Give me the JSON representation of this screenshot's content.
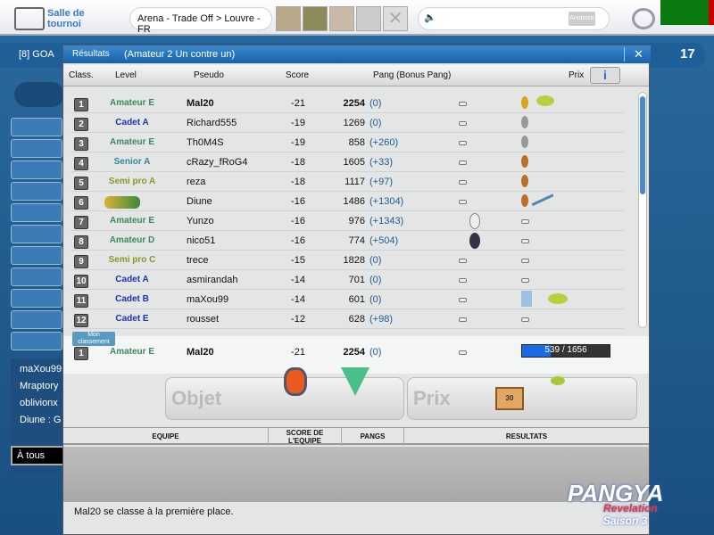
{
  "topbar": {
    "lobby_label": "Salle de tournoi",
    "location": "Arena - Trade Off > Louvre - FR",
    "announce_button": "Annonce"
  },
  "room": {
    "info": "[8]  GOA",
    "count": "17"
  },
  "dialog": {
    "title": "Résultats",
    "subtitle": "(Amateur 2 Un contre un)",
    "columns": [
      "Class.",
      "Level",
      "Pseudo",
      "Score",
      "Pang (Bonus Pang)",
      "Prix"
    ],
    "rows": [
      {
        "rank": "1",
        "level": "Amateur E",
        "pseudo": "Mal20",
        "score": "-21",
        "pang": "2254",
        "bonus": "(0)",
        "prize": "gold-medal"
      },
      {
        "rank": "2",
        "level": "Cadet A",
        "pseudo": "Richard555",
        "score": "-19",
        "pang": "1269",
        "bonus": "(0)",
        "prize": "silver-medal"
      },
      {
        "rank": "3",
        "level": "Amateur E",
        "pseudo": "Th0M4S",
        "score": "-19",
        "pang": "858",
        "bonus": "(+260)",
        "prize": "silver-medal"
      },
      {
        "rank": "4",
        "level": "Senior A",
        "pseudo": "cRazy_fRoG4",
        "score": "-18",
        "pang": "1605",
        "bonus": "(+33)",
        "prize": "bronze-medal"
      },
      {
        "rank": "5",
        "level": "Semi pro A",
        "pseudo": "reza",
        "score": "-18",
        "pang": "1117",
        "bonus": "(+97)",
        "prize": "bronze-medal"
      },
      {
        "rank": "6",
        "level": "",
        "pseudo": "Diune",
        "score": "-16",
        "pang": "1486",
        "bonus": "(+1304)",
        "prize": "bronze-medal"
      },
      {
        "rank": "7",
        "level": "Amateur E",
        "pseudo": "Yunzo",
        "score": "-16",
        "pang": "976",
        "bonus": "(+1343)",
        "prize": "none"
      },
      {
        "rank": "8",
        "level": "Amateur D",
        "pseudo": "nico51",
        "score": "-16",
        "pang": "774",
        "bonus": "(+504)",
        "prize": "none"
      },
      {
        "rank": "9",
        "level": "Semi pro C",
        "pseudo": "trece",
        "score": "-15",
        "pang": "1828",
        "bonus": "(0)",
        "prize": "none"
      },
      {
        "rank": "10",
        "level": "Cadet A",
        "pseudo": "asmirandah",
        "score": "-14",
        "pang": "701",
        "bonus": "(0)",
        "prize": "none"
      },
      {
        "rank": "11",
        "level": "Cadet B",
        "pseudo": "maXou99",
        "score": "-14",
        "pang": "601",
        "bonus": "(0)",
        "prize": "figure"
      },
      {
        "rank": "12",
        "level": "Cadet E",
        "pseudo": "rousset",
        "score": "-12",
        "pang": "628",
        "bonus": "(+98)",
        "prize": "none"
      }
    ],
    "my_rank": {
      "tag": "Mon classement",
      "rank": "1",
      "level": "Amateur E",
      "pseudo": "Mal20",
      "score": "-21",
      "pang": "2254",
      "bonus": "(0)",
      "progress": "539 / 1656",
      "progress_fraction": 0.325
    },
    "objet_label": "Objet",
    "prix_label": "Prix",
    "trophy_number": "30",
    "team_columns": [
      "EQUIPE",
      "SCORE DE L'EQUIPE",
      "PANGS",
      "RESULTATS"
    ],
    "message": "Mal20 se classe à la première place."
  },
  "chat": {
    "names": [
      "maXou99",
      "Mraptory",
      "oblivionx",
      "Diune : G"
    ],
    "channel": "À tous"
  },
  "logo": {
    "text": "PANGYA Revelation Saison 3"
  },
  "colors": {
    "amateur": "#3a8a5e",
    "cadet": "#1a35a8",
    "senior": "#2a8a9c",
    "semipro": "#8a962a",
    "accent": "#1761a8"
  }
}
